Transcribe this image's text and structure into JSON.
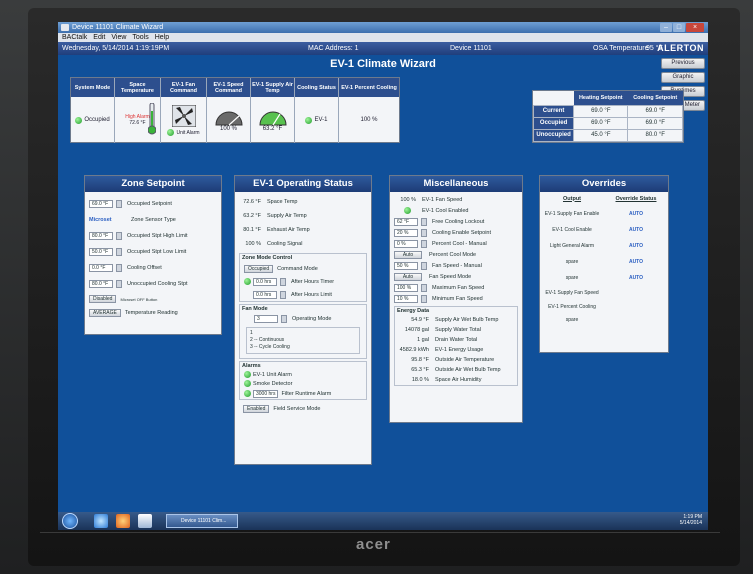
{
  "window": {
    "title": "Device 11101 Climate Wizard",
    "menu": [
      "BACtalk",
      "Edit",
      "View",
      "Tools",
      "Help"
    ]
  },
  "infobar": {
    "datetime": "Wednesday, 5/14/2014 1:19:19PM",
    "mac": "MAC Address: 1",
    "device": "Device 11101",
    "osa_label": "OSA Temperature",
    "osa_value": "95 °F",
    "logo": "ALERTON"
  },
  "app_title": "EV-1 Climate Wizard",
  "nav_buttons": [
    "Previous",
    "Graphic",
    "Runtimes",
    "Power Meter"
  ],
  "system_status": {
    "headers": [
      "System Mode",
      "Space Temperature",
      "EV-1 Fan Command",
      "EV-1 Speed Command",
      "EV-1 Supply Air Temp",
      "Cooling Status",
      "EV-1 Percent Cooling"
    ],
    "mode": "Occupied",
    "alarm_text": "High Alarm",
    "space_temp": "72.6 °F",
    "fan_alarm": "Unit Alarm",
    "speed": "100 %",
    "supply_temp": "63.2 °F",
    "cooling_status": "EV-1",
    "percent_cooling": "100 %"
  },
  "setpoints": {
    "headers": [
      "",
      "Heating Setpoint",
      "Cooling Setpoint"
    ],
    "rows": [
      {
        "label": "Current",
        "heat": "69.0 °F",
        "cool": "69.0 °F"
      },
      {
        "label": "Occupied",
        "heat": "69.0 °F",
        "cool": "69.0 °F"
      },
      {
        "label": "Unoccupied",
        "heat": "45.0 °F",
        "cool": "80.0 °F"
      }
    ]
  },
  "zone_setpoint": {
    "title": "Zone Setpoint",
    "rows": [
      {
        "value": "69.0 °F",
        "label": "Occupied Setpoint"
      },
      {
        "value": "Microset",
        "label": "Zone Sensor Type"
      },
      {
        "value": "80.0 °F",
        "label": "Occupied Stpt High Limit"
      },
      {
        "value": "50.0 °F",
        "label": "Occupied Stpt Low Limit"
      },
      {
        "value": "0.0 °F",
        "label": "Cooling Offset"
      },
      {
        "value": "80.0 °F",
        "label": "Unoccupied Cooling Stpt"
      },
      {
        "value": "Disabled",
        "label": "Microset OFF Button"
      },
      {
        "value": "AVERAGE",
        "label": "Temperature Reading"
      }
    ]
  },
  "operating_status": {
    "title": "EV-1 Operating Status",
    "readings": [
      {
        "value": "72.6 °F",
        "label": "Space Temp"
      },
      {
        "value": "63.2 °F",
        "label": "Supply Air Temp"
      },
      {
        "value": "80.1 °F",
        "label": "Exhaust Air Temp"
      },
      {
        "value": "100 %",
        "label": "Cooling Signal"
      }
    ],
    "zone_mode_title": "Zone Mode Control",
    "zone_mode": [
      {
        "value": "Occupied",
        "label": "Command Mode"
      },
      {
        "value": "0.0 hrs",
        "label": "After Hours Timer"
      },
      {
        "value": "0.0 hrs",
        "label": "After Hours Limit"
      }
    ],
    "fan_mode_title": "Fan Mode",
    "fan_mode_value": "3",
    "fan_mode_label": "Operating Mode",
    "fan_mode_options": [
      "1",
      "2 -- Continuous",
      "3 -- Cycle Cooling"
    ],
    "alarms_title": "Alarms",
    "alarms": [
      "EV-1 Unit Alarm",
      "Smoke Detector"
    ],
    "filter_value": "3000 hrs",
    "filter_label": "Filter Runtime Alarm",
    "field_value": "Enabled",
    "field_label": "Field Service Mode"
  },
  "misc": {
    "title": "Miscellaneous",
    "rows": [
      {
        "value": "100 %",
        "label": "EV-1 Fan Speed"
      },
      {
        "value": "",
        "label": "EV-1 Cool Enabled"
      },
      {
        "value": "62 °F",
        "label": "Free Cooling Lockout"
      },
      {
        "value": "20 %",
        "label": "Cooling Enable Setpoint"
      },
      {
        "value": "0 %",
        "label": "Percent Cool - Manual"
      },
      {
        "value": "Auto",
        "label": "Percent Cool Mode"
      },
      {
        "value": "50 %",
        "label": "Fan Speed - Manual"
      },
      {
        "value": "Auto",
        "label": "Fan Speed Mode"
      },
      {
        "value": "100 %",
        "label": "Maximum Fan Speed"
      },
      {
        "value": "10 %",
        "label": "Minimum Fan Speed"
      }
    ],
    "energy_title": "Energy Data",
    "energy": [
      {
        "value": "54.9 °F",
        "label": "Supply Air Wet Bulb Temp"
      },
      {
        "value": "14078 gal",
        "label": "Supply Water Total"
      },
      {
        "value": "1 gal",
        "label": "Drain Water Total"
      },
      {
        "value": "4582.9 kWh",
        "label": "EV-1 Energy Usage"
      },
      {
        "value": "95.8 °F",
        "label": "Outside Air Temperature"
      },
      {
        "value": "65.3 °F",
        "label": "Outside Air Wet Bulb Temp"
      },
      {
        "value": "18.0 %",
        "label": "Space Air Humidity"
      }
    ]
  },
  "overrides": {
    "title": "Overrides",
    "col_output": "Output",
    "col_status": "Override Status",
    "rows": [
      {
        "output": "EV-1 Supply Fan Enable",
        "status": "AUTO"
      },
      {
        "output": "EV-1 Cool Enable",
        "status": "AUTO"
      },
      {
        "output": "Light General Alarm",
        "status": "AUTO"
      },
      {
        "output": "spare",
        "status": "AUTO"
      },
      {
        "output": "spare",
        "status": "AUTO"
      },
      {
        "output": "EV-1 Supply Fan Speed",
        "status": ""
      },
      {
        "output": "EV-1 Percent Cooling",
        "status": ""
      },
      {
        "output": "spare",
        "status": ""
      }
    ]
  },
  "taskbar": {
    "task": "Device 11101 Clim...",
    "time": "1:19 PM",
    "date": "5/14/2014"
  },
  "monitor_brand": "acer",
  "colors": {
    "accent": "#2d4f8e",
    "desktop": "#10509a",
    "ok_led": "#1f9b2a"
  }
}
